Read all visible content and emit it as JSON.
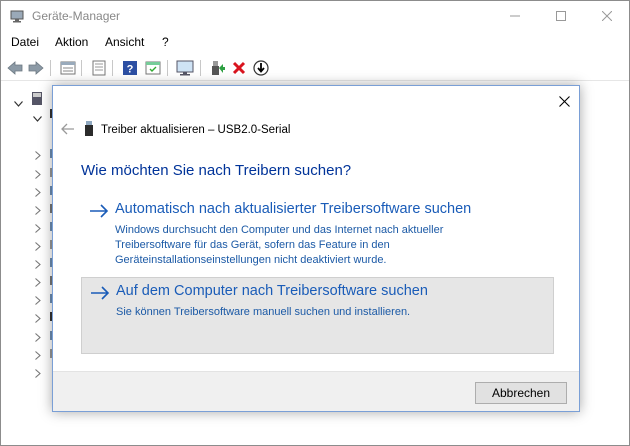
{
  "window": {
    "title": "Geräte-Manager",
    "controls": [
      "minimize",
      "maximize",
      "close"
    ]
  },
  "menubar": {
    "items": [
      {
        "label": "Datei"
      },
      {
        "label": "Aktion"
      },
      {
        "label": "Ansicht"
      },
      {
        "label": "?"
      }
    ]
  },
  "toolbar": {
    "icons": [
      "back-icon",
      "forward-icon",
      "properties-icon",
      "view-icon",
      "help-icon",
      "action-icon",
      "monitor-scan-icon",
      "update-driver-icon",
      "uninstall-icon",
      "disable-icon"
    ]
  },
  "dialog": {
    "title": "Treiber aktualisieren – USB2.0-Serial",
    "heading": "Wie möchten Sie nach Treibern suchen?",
    "option_auto": {
      "title": "Automatisch nach aktualisierter Treibersoftware suchen",
      "description": "Windows durchsucht den Computer und das Internet nach aktueller Treibersoftware für das Gerät, sofern das Feature in den Geräteinstallationseinstellungen nicht deaktiviert wurde."
    },
    "option_manual": {
      "title": "Auf dem Computer nach Treibersoftware suchen",
      "description": "Sie können Treibersoftware manuell suchen und installieren."
    },
    "cancel_label": "Abbrechen"
  },
  "colors": {
    "heading": "#003399",
    "link": "#1a5cb8",
    "selected_option_bg": "#e6e6e6",
    "uninstall_red": "#d9141e"
  }
}
